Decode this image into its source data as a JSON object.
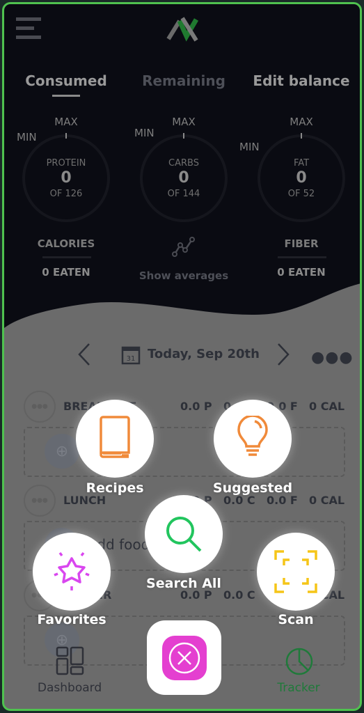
{
  "tabs": [
    {
      "label": "Consumed",
      "active": true
    },
    {
      "label": "Remaining"
    },
    {
      "label": "Edit balance"
    }
  ],
  "gauges": [
    {
      "name": "PROTEIN",
      "value": "0",
      "of": "OF 126",
      "min": "MIN",
      "max": "MAX"
    },
    {
      "name": "CARBS",
      "value": "0",
      "of": "OF 144",
      "min": "MIN",
      "max": "MAX"
    },
    {
      "name": "FAT",
      "value": "0",
      "of": "OF 52",
      "min": "MIN",
      "max": "MAX"
    }
  ],
  "calories": {
    "label": "CALORIES",
    "value": "0 EATEN"
  },
  "fiber": {
    "label": "FIBER",
    "value": "0 EATEN"
  },
  "averages": {
    "label": "Show averages",
    "icon": "line-chart-icon"
  },
  "date": {
    "label": "Today, Sep 20th",
    "calendar_day": "31"
  },
  "meals": [
    {
      "name": "BREAKFAST",
      "p": "0.0 P",
      "c": "0.0 C",
      "f": "0.0 F",
      "cal": "0 CAL"
    },
    {
      "name": "LUNCH",
      "p": "0.0 P",
      "c": "0.0 C",
      "f": "0.0 F",
      "cal": "0 CAL",
      "add": "Add food"
    },
    {
      "name": "DINNER",
      "p": "0.0 P",
      "c": "0.0 C",
      "f": "0.0 F",
      "cal": "0 CAL"
    }
  ],
  "actions": {
    "recipes": "Recipes",
    "suggested": "Suggested",
    "search": "Search All",
    "favorites": "Favorites",
    "scan": "Scan"
  },
  "nav": {
    "dashboard": "Dashboard",
    "tracker": "Tracker",
    "active": "Tracker"
  },
  "colors": {
    "frame": "#4fc24f",
    "recipes": "#f08a3a",
    "suggested": "#f08a3a",
    "search": "#22c55e",
    "favorites": "#d946ef",
    "scan": "#f5c518",
    "close": "#e43fd0",
    "tracker": "#1f7a3a"
  }
}
